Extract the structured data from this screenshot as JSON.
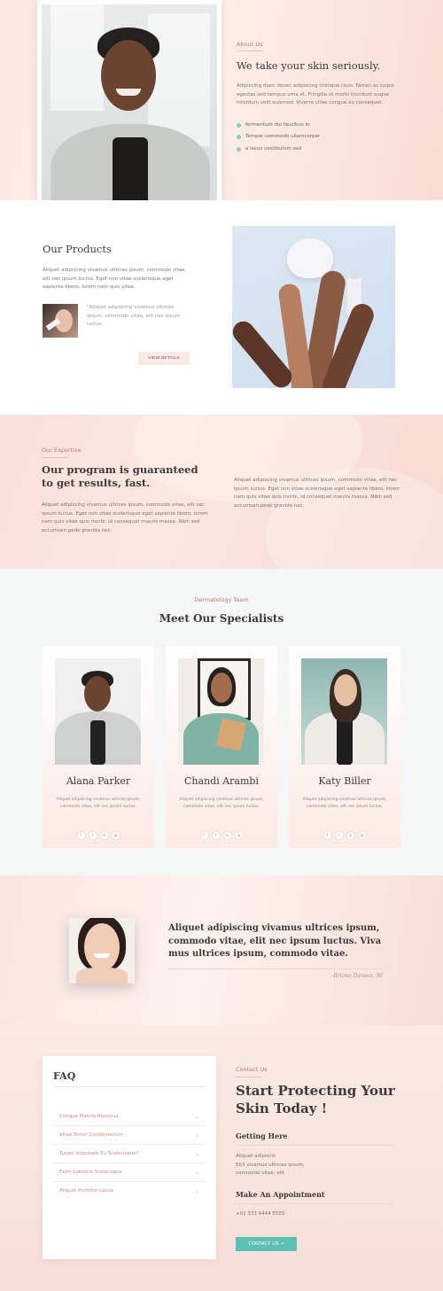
{
  "about": {
    "label": "About Us",
    "title": "We take your skin seriously.",
    "text": "Adipiscing diam donec adipiscing tristique risus. Fames ac turpis egestas sed tempus urna et. Fringilla ut morbi tincidunt augue interdum velit euismod. Viverra vitae congue eu consequat.",
    "bullets": [
      "fermentum dui faucibus in",
      "Tempor commodo ullamcorper",
      "a lacus vestibulum sed"
    ]
  },
  "products": {
    "title": "Our Products",
    "text": "Aliquet adipiscing vivamus ultrices ipsum, commodo vitae, elit nec ipsum luctus. Eget non vitae scelerisque eget sapiente libero, lorem nam quis vitae.",
    "quote": "\"Aliquet adipiscing vivamus ultrices ipsum, commodo vitae, elit nec ipsum luctus.",
    "button": "VIEW DETAILS"
  },
  "expertise": {
    "label": "Our Expertise",
    "title_line1": "Our program is guaranteed",
    "title_line2": "to get results, fast.",
    "text_left": "Aliquet adipiscing vivamus ultrices ipsum, commodo vitae, elit nec ipsum luctus. Eget non vitae scelerisque eget sapiente libero, lorem nam quis vitae quis morbi, id consequat mauris massa. Nibh sed accumsan pede gravida nec.",
    "text_right": "Aliquet adipiscing vivamus ultrices ipsum, commodo vitae, elit nec ipsum luctus. Eget non vitae scelerisque eget sapiente libero, lorem nam quis vitae quis morbi, id consequat mauris massa. Nibh sed accumsan pede gravida nec."
  },
  "specialists": {
    "label": "Dermatology Team",
    "title": "Meet Our Specialists",
    "members": [
      {
        "name": "Alana Parker",
        "desc": "Aliquet adipiscing vivamus ultrices ipsum, commodo vitae, elit nec ipsum luctus."
      },
      {
        "name": "Chandi Arambi",
        "desc": "Aliquet adipiscing vivamus ultrices ipsum, commodo vitae, elit nec ipsum luctus."
      },
      {
        "name": "Katy Biller",
        "desc": "Aliquet adipiscing vivamus ultrices ipsum, commodo vitae, elit nec ipsum luctus."
      }
    ],
    "social_icons": [
      "f",
      "t",
      "in",
      "ig"
    ]
  },
  "testimonial": {
    "quote": "Aliquet adipiscing vivamus ultrices ipsum, commodo vitae, elit nec ipsum luctus. Viva mus ultrices ipsum, commodo vitae.",
    "author": "-Briana Davees, 36"
  },
  "faq": {
    "title": "FAQ",
    "items": [
      "Congue Mauris Rhoncus",
      "Vitae Tortor Condimentum",
      "Turpis Vulputate Eu Scelerisque?",
      "Enim Lobortis Scelerisque",
      "Aliquet Porttitor Lacus"
    ]
  },
  "contact": {
    "label": "Contact Us",
    "title_line1": "Start Protecting Your",
    "title_line2": "Skin Today !",
    "getting_here": "Getting Here",
    "address_line1": "Aliquet adipiscin",
    "address_line2": "553 vivamus ultrices ipsum,",
    "address_line3": "commodo vitae, elit",
    "appointment": "Make An Appointment",
    "phone": "+01 333 4444 5555",
    "button": "CONTACT US ↗"
  },
  "colors": {
    "accent": "#5ebfb4",
    "pink": "#fbe9e4",
    "label": "#b07e74"
  }
}
